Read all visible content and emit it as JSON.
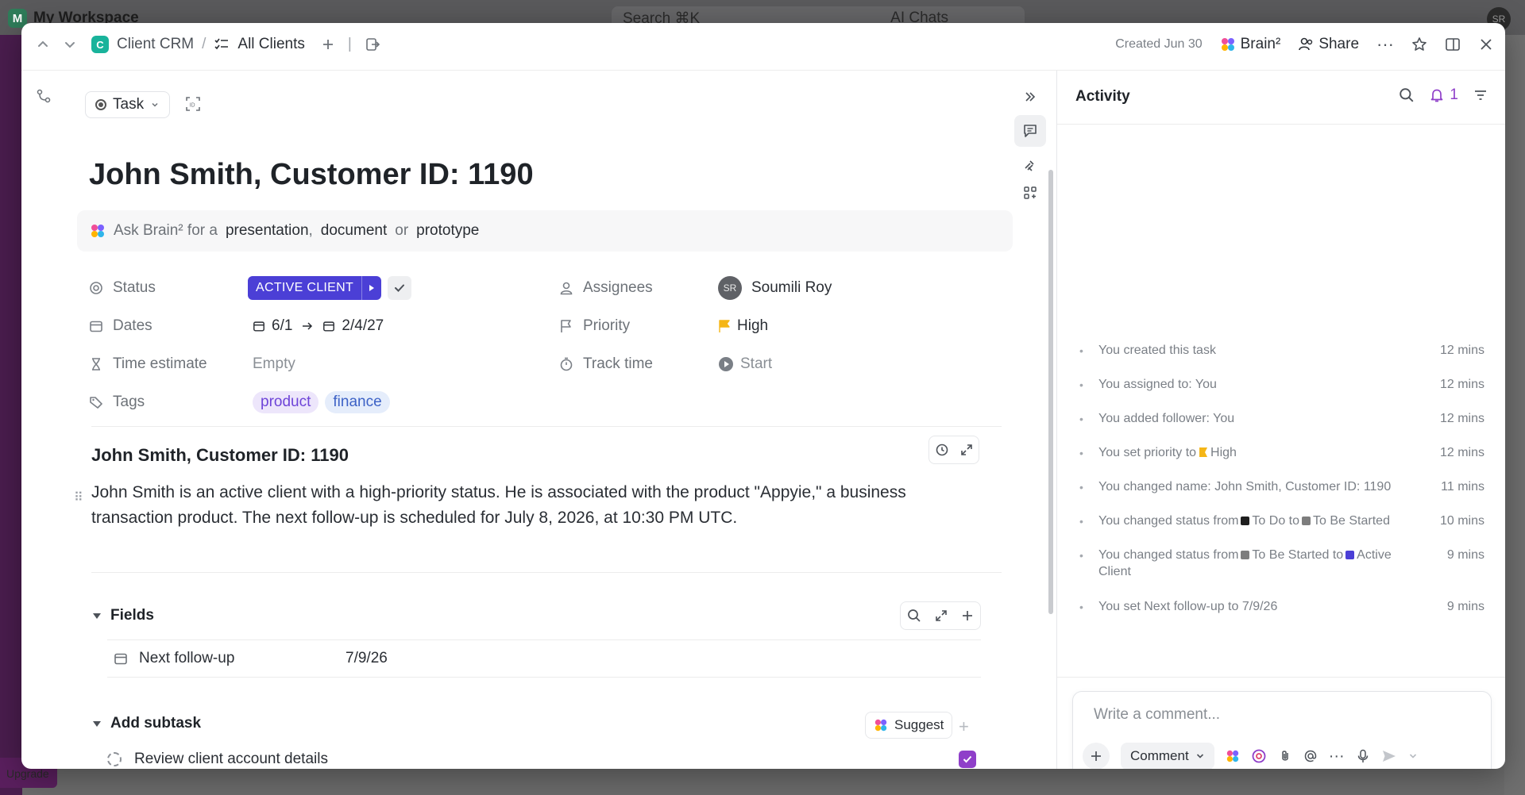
{
  "background": {
    "workspace_badge": "M",
    "workspace": "My Workspace",
    "search_placeholder": "Search ⌘K",
    "ai_chats": "AI Chats",
    "upgrade": "Upgrade",
    "avatar": "SR"
  },
  "topbar": {
    "space_badge": "C",
    "space": "Client CRM",
    "separator": "/",
    "list": "All Clients",
    "created": "Created Jun 30",
    "brain": "Brain²",
    "share": "Share"
  },
  "task": {
    "type": "Task",
    "title": "John Smith, Customer ID: 1190",
    "brain_prompt": {
      "prefix": "Ask Brain² for a",
      "opt1": "presentation",
      "comma": ",",
      "opt2": "document",
      "or": "or",
      "opt3": "prototype"
    }
  },
  "properties": {
    "status": {
      "label": "Status",
      "value": "ACTIVE CLIENT",
      "color": "#4b3fd6"
    },
    "dates": {
      "label": "Dates",
      "start": "6/1",
      "end": "2/4/27"
    },
    "time_estimate": {
      "label": "Time estimate",
      "value": "Empty"
    },
    "tags": {
      "label": "Tags",
      "items": [
        "product",
        "finance"
      ]
    },
    "assignees": {
      "label": "Assignees",
      "initials": "SR",
      "name": "Soumili Roy"
    },
    "priority": {
      "label": "Priority",
      "value": "High",
      "color": "#f5b617"
    },
    "track_time": {
      "label": "Track time",
      "value": "Start"
    }
  },
  "description": {
    "title": "John Smith, Customer ID: 1190",
    "body": "John Smith is an active client with a high-priority status. He is associated with the product \"Appyie,\" a business transaction product. The next follow-up is scheduled for July 8, 2026, at 10:30 PM UTC."
  },
  "fields": {
    "heading": "Fields",
    "rows": [
      {
        "name": "Next follow-up",
        "value": "7/9/26"
      }
    ]
  },
  "subtasks": {
    "heading": "Add subtask",
    "suggest": "Suggest",
    "items": [
      {
        "name": "Review client account details",
        "done": true
      }
    ]
  },
  "activity": {
    "title": "Activity",
    "notifications": "1",
    "events": [
      {
        "parts": [
          "You created this task"
        ],
        "time": "12 mins"
      },
      {
        "parts": [
          "You assigned to: You"
        ],
        "time": "12 mins"
      },
      {
        "parts": [
          "You added follower: You"
        ],
        "time": "12 mins"
      },
      {
        "parts": [
          "You set priority to",
          "High"
        ],
        "time": "12 mins"
      },
      {
        "parts": [
          "You changed name: John Smith, Customer ID: 1190"
        ],
        "time": "11 mins"
      },
      {
        "parts": [
          "You changed status from",
          "To Do",
          "to",
          "To Be Started"
        ],
        "time": "10 mins"
      },
      {
        "parts": [
          "You changed status from",
          "To Be Started",
          "to",
          "Active Client"
        ],
        "time": "9 mins"
      },
      {
        "parts": [
          "You set Next follow-up to",
          "7/9/26"
        ],
        "time": "9 mins"
      }
    ],
    "status_colors": {
      "todo": "#1f1f1f",
      "to_be_started": "#7d7d7d",
      "active_client": "#4b3fd6"
    },
    "comment_placeholder": "Write a comment...",
    "comment_type": "Comment"
  }
}
